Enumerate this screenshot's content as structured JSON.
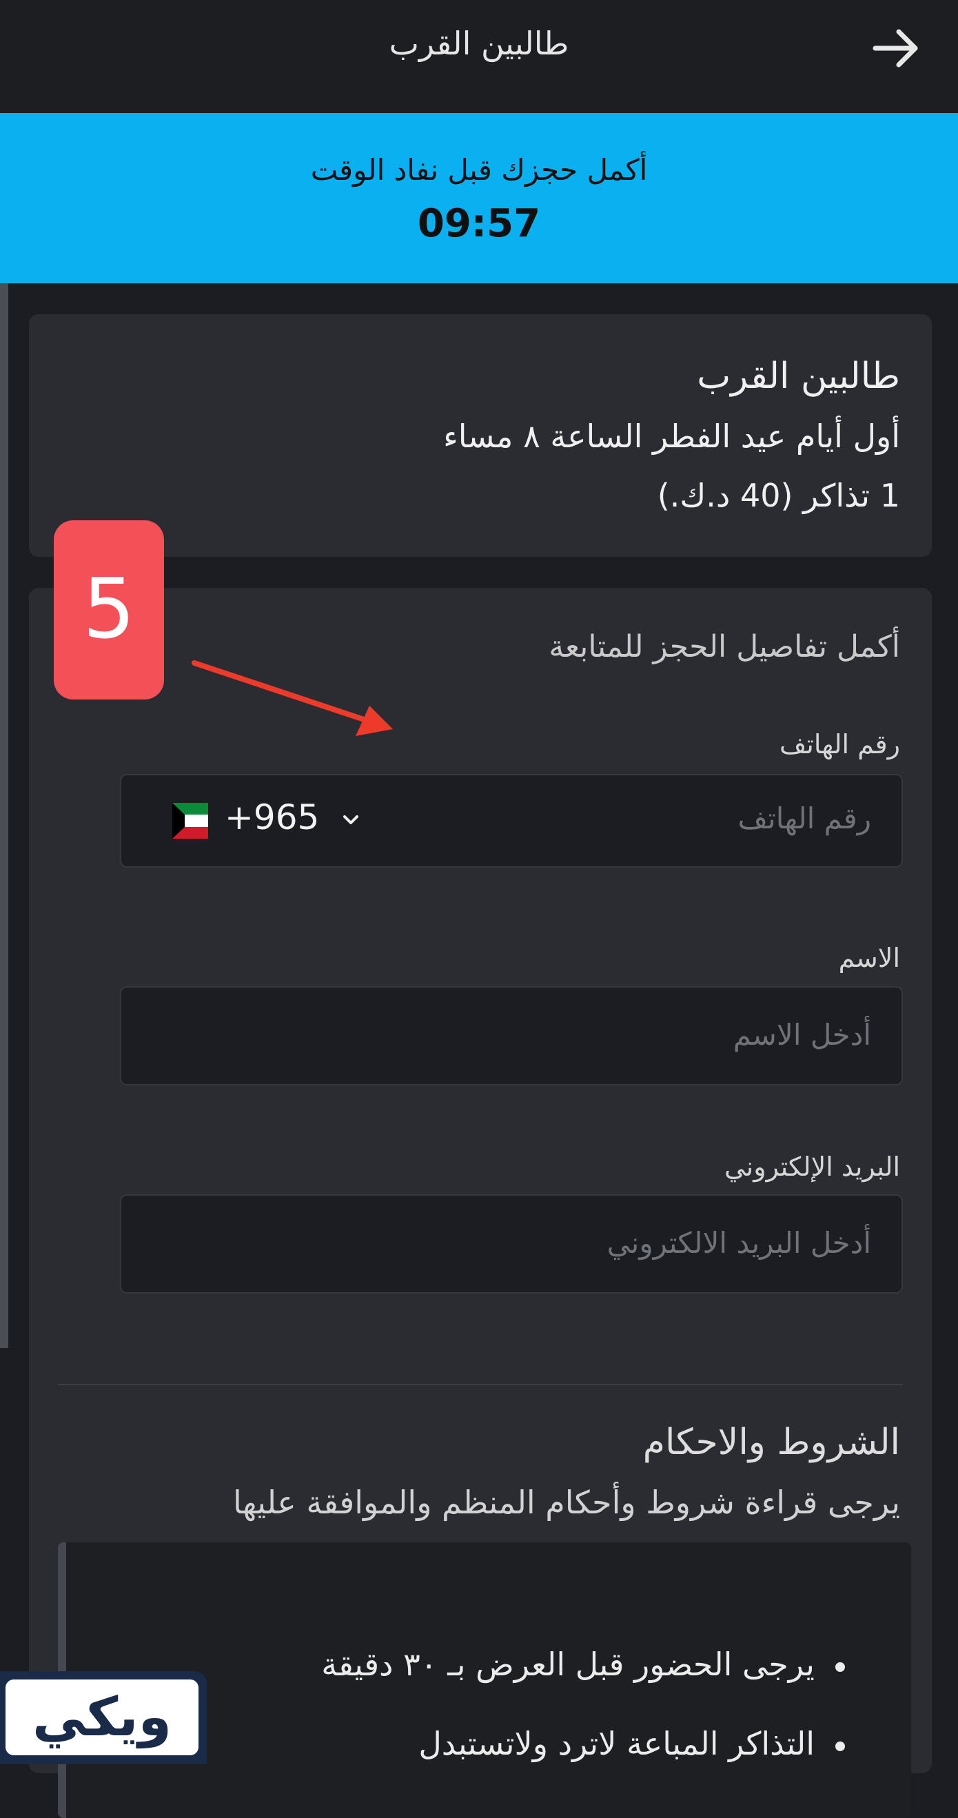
{
  "header": {
    "title": "طالبين القرب",
    "back_icon": "arrow-right-icon"
  },
  "timer": {
    "message": "أكمل حجزك قبل نفاد الوقت",
    "time": "09:57"
  },
  "summary": {
    "event_name": "طالبين القرب",
    "date_time": "أول أيام عيد الفطر الساعة ٨ مساء",
    "tickets": "1 تذاكر (40 د.ك.)"
  },
  "form": {
    "title": "أكمل تفاصيل الحجز للمتابعة",
    "phone": {
      "label": "رقم الهاتف",
      "placeholder": "رقم الهاتف",
      "country_code": "+965",
      "flag_icon": "kuwait-flag-icon"
    },
    "name": {
      "label": "الاسم",
      "placeholder": "أدخل الاسم"
    },
    "email": {
      "label": "البريد الإلكتروني",
      "placeholder": "أدخل البريد الالكتروني"
    }
  },
  "terms": {
    "title": "الشروط والاحكام",
    "subtitle": "يرجى قراءة شروط وأحكام المنظم والموافقة عليها",
    "items": [
      "يرجى الحضور قبل العرض بـ ٣٠ دقيقة",
      "التذاكر المباعة لاترد ولاتستبدل"
    ]
  },
  "annotation": {
    "step_number": "5"
  },
  "watermark": {
    "logo_text": "ويكي"
  },
  "colors": {
    "timer_bg": "#0bb0f0",
    "badge": "#f45058",
    "arrow": "#ee3a2a"
  }
}
